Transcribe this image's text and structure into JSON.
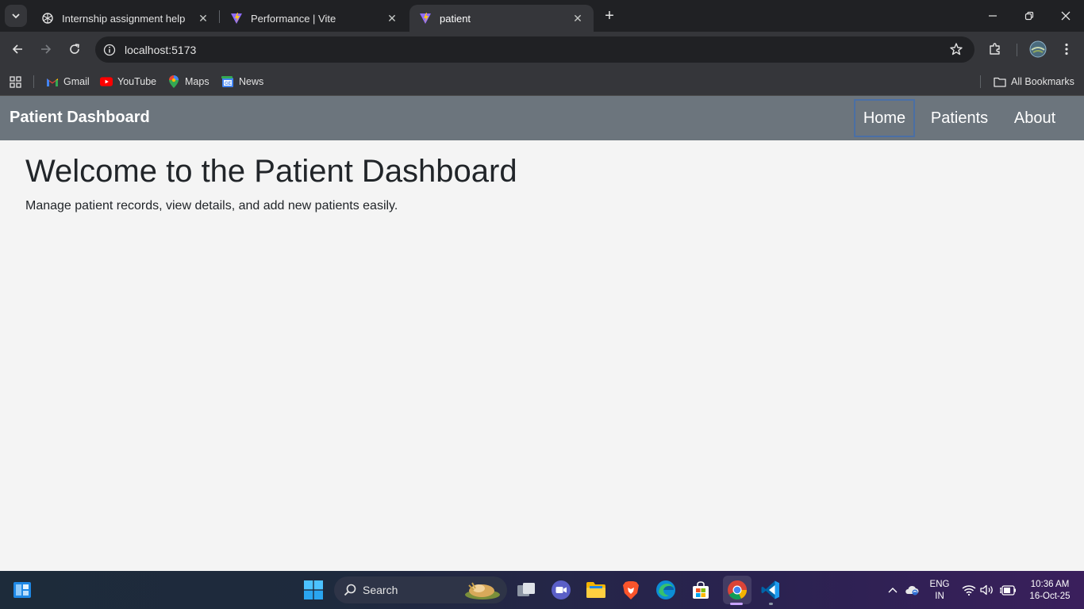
{
  "browser": {
    "tabs": [
      {
        "title": "Internship assignment help",
        "icon": "openai-icon"
      },
      {
        "title": "Performance | Vite",
        "icon": "vite-icon"
      },
      {
        "title": "patient",
        "icon": "vite-icon",
        "active": true
      }
    ],
    "url": "localhost:5173",
    "bookmarks": [
      {
        "label": "Gmail",
        "icon": "gmail-icon"
      },
      {
        "label": "YouTube",
        "icon": "youtube-icon"
      },
      {
        "label": "Maps",
        "icon": "maps-icon"
      },
      {
        "label": "News",
        "icon": "news-icon"
      }
    ],
    "all_bookmarks": "All Bookmarks"
  },
  "app": {
    "brand": "Patient Dashboard",
    "nav": [
      {
        "label": "Home",
        "focused": true
      },
      {
        "label": "Patients"
      },
      {
        "label": "About"
      }
    ],
    "heading": "Welcome to the Patient Dashboard",
    "subtitle": "Manage patient records, view details, and add new patients easily."
  },
  "taskbar": {
    "search_label": "Search",
    "lang": "ENG",
    "region": "IN",
    "time": "10:36 AM",
    "date": "16-Oct-25"
  },
  "colors": {
    "navbar": "#6c757d",
    "page_bg": "#f4f4f4",
    "chrome_dark": "#202124",
    "chrome_mid": "#35363a"
  }
}
